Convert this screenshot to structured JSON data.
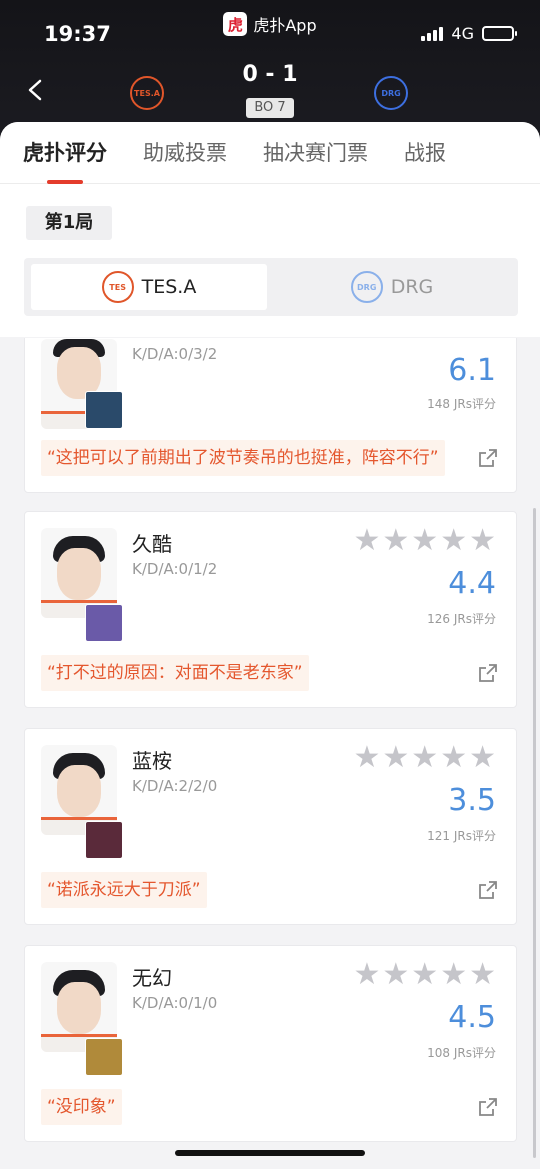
{
  "status": {
    "time": "19:37",
    "app_name": "虎扑App",
    "app_icon_char": "虎",
    "network": "4G",
    "battery_level": 1.0
  },
  "match": {
    "score": "0 - 1",
    "format": "BO 7",
    "team_a_logo": "TES.A",
    "team_b_logo": "DRG"
  },
  "tabs": [
    {
      "label": "虎扑评分",
      "active": true
    },
    {
      "label": "助威投票",
      "active": false
    },
    {
      "label": "抽决赛门票",
      "active": false
    },
    {
      "label": "战报",
      "active": false
    }
  ],
  "game": {
    "label": "第1局"
  },
  "team_switch": {
    "team_a": "TES.A",
    "team_b": "DRG",
    "active": "TES.A"
  },
  "players": [
    {
      "name": "",
      "kda": "K/D/A:0/3/2",
      "rating": "6.1",
      "votes": "148 JRs评分",
      "comment": "“这把可以了前期出了波节奏吊的也挺准，阵容不行”",
      "hero_color": "#2a4a6a"
    },
    {
      "name": "久酷",
      "kda": "K/D/A:0/1/2",
      "rating": "4.4",
      "votes": "126 JRs评分",
      "comment": "“打不过的原因：对面不是老东家”",
      "hero_color": "#6a5aa8"
    },
    {
      "name": "蓝桉",
      "kda": "K/D/A:2/2/0",
      "rating": "3.5",
      "votes": "121 JRs评分",
      "comment": "“诺派永远大于刀派”",
      "hero_color": "#5a2a3a"
    },
    {
      "name": "无幻",
      "kda": "K/D/A:0/1/0",
      "rating": "4.5",
      "votes": "108 JRs评分",
      "comment": "“没印象”",
      "hero_color": "#b08a3a"
    }
  ],
  "colors": {
    "accent": "#e43c2c",
    "rating": "#4d8edb",
    "comment": "#e4572e",
    "star": "#c5c5ca"
  },
  "icons": {
    "back": "chevron-left-icon",
    "share": "share-icon",
    "star": "star-icon"
  }
}
